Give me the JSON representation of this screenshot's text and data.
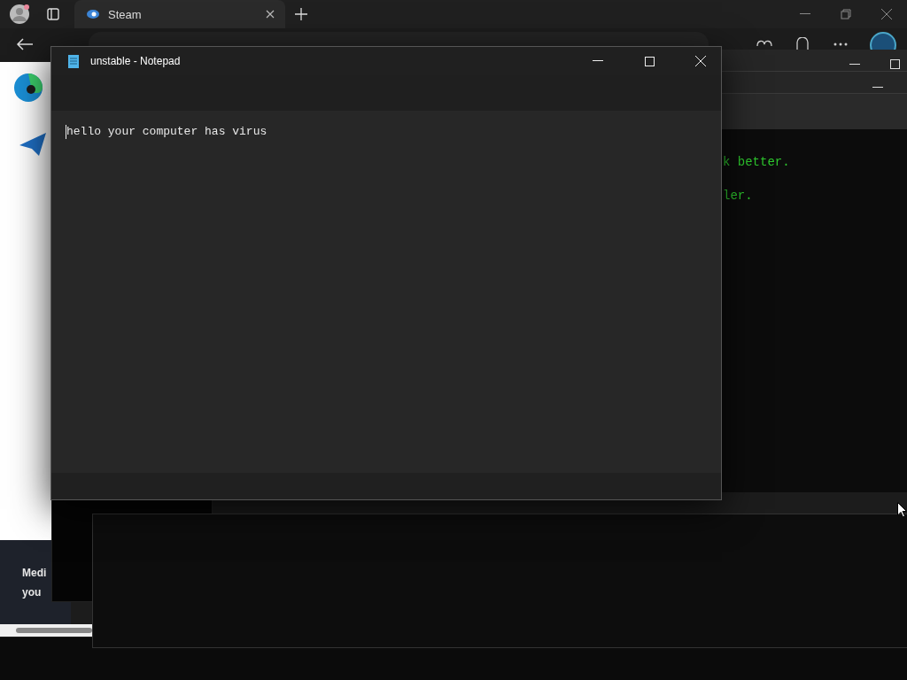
{
  "browser": {
    "tab": {
      "title": "Steam"
    },
    "page_lines": [
      "Medi",
      "you"
    ]
  },
  "console": {
    "lines": [
      "k better.",
      "ler."
    ]
  },
  "notepad": {
    "title": "unstable - Notepad",
    "content": "hello your computer has virus"
  }
}
